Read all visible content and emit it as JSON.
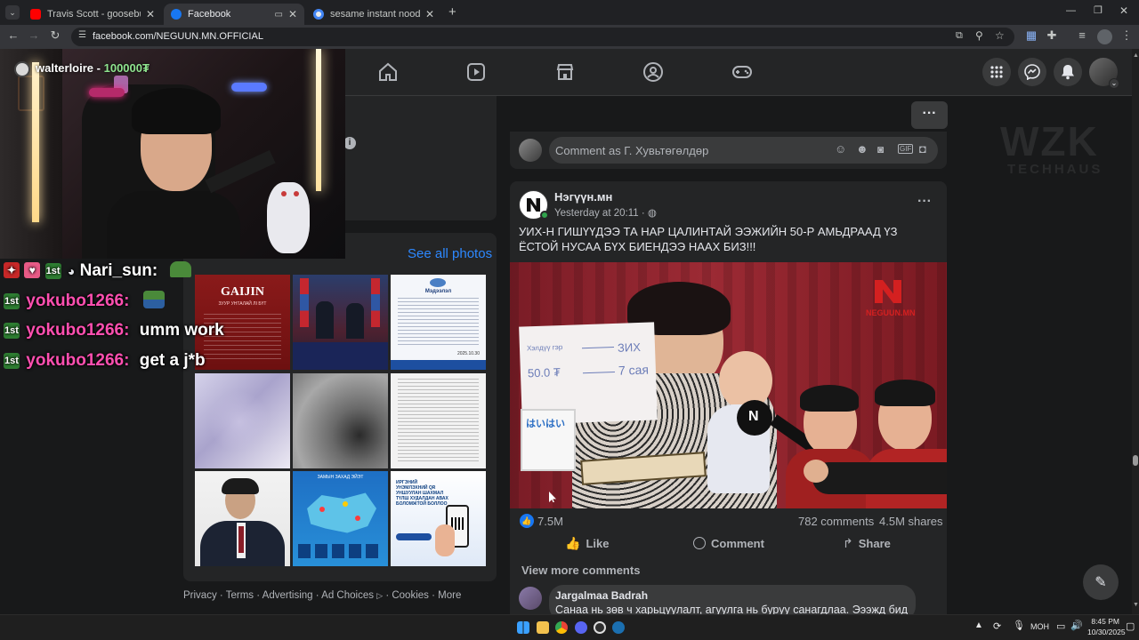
{
  "browser": {
    "tabs": [
      {
        "title": "Travis Scott - goosebumps ft. K",
        "favicon_color": "#ff0000"
      },
      {
        "title": "Facebook",
        "favicon_color": "#1877f2"
      },
      {
        "title": "sesame instant noodles - Goog",
        "favicon_color": "#4285f4"
      }
    ],
    "url": "facebook.com/NEGUUN.MN.OFFICIAL"
  },
  "stream": {
    "streamer_name": "walterloire",
    "streamer_balance": "100000₮",
    "watermark": "WZK",
    "watermark_sub": "TECHHAUS",
    "chat": [
      {
        "user": "Nari_sun:",
        "msg": "",
        "user_color": "#ffffff"
      },
      {
        "user": "yokubo1266:",
        "msg": "",
        "user_color": "#ff4fb0"
      },
      {
        "user": "yokubo1266:",
        "msg": "umm work",
        "user_color": "#ff4fb0"
      },
      {
        "user": "yokubo1266:",
        "msg": "get a j*b",
        "user_color": "#ff4fb0"
      }
    ]
  },
  "photos_card": {
    "see_all": "See all photos",
    "photo_captions": {
      "p1_title": "GAIJIN",
      "p1_sub": "ЗУУР УНТАЛАЙ ЛІ БҮТ",
      "p3_title": "Мэдээлэл",
      "p3_date": "2025.10.30",
      "p8_text": "ЗАМЫН ЗАХАД ЭЙЭТ",
      "p9_title": "ИРГЭНИЙ УНЭМЛЭХНИЙ QR УНШУУЛАН ШАХМАЛ ТҮЛШ ХУДАЛДАН АВАХ БОЛОМЖТОЙ БОЛЛОО"
    }
  },
  "footer_links": [
    "Privacy",
    "Terms",
    "Advertising",
    "Ad Choices",
    "Cookies",
    "More"
  ],
  "footer_separator": "·",
  "comment_box": {
    "placeholder": "Comment as Г. Хувьтөгөлдөр"
  },
  "post": {
    "page_name": "Нэгүүн.мн",
    "time": "Yesterday at 20:11",
    "text": "УИХ-Н ГИШҮҮДЭЭ ТА НАР ЦАЛИНТАЙ ЭЭЖИЙН 50-Р АМЬДРААД ҮЗ ЁСТОЙ НУСАА БҮХ БИЕНДЭЭ НААХ БИЗ!!!",
    "image_watermark": "NEGUUN.MN",
    "paper_line1": "Хэлдүү гэр",
    "paper_line2": "50.0 ₮",
    "paper_right1": "ЗИХ",
    "paper_right2": "7 сая",
    "mic_letter": "N",
    "box_text": "はいはい",
    "reactions": "7.5M",
    "comments": "782 comments",
    "shares": "4.5M shares",
    "like": "Like",
    "comment": "Comment",
    "share": "Share",
    "view_more": "View more comments",
    "first_comment_author": "Jargalmaa Badrah",
    "first_comment_text": "Санаа нь зөв ч харьцуулалт, агуулга нь буруу санагдлаа. Эээжд бид"
  },
  "taskbar": {
    "lang": "МОН",
    "time": "8:45 PM",
    "date": "10/30/2025"
  }
}
